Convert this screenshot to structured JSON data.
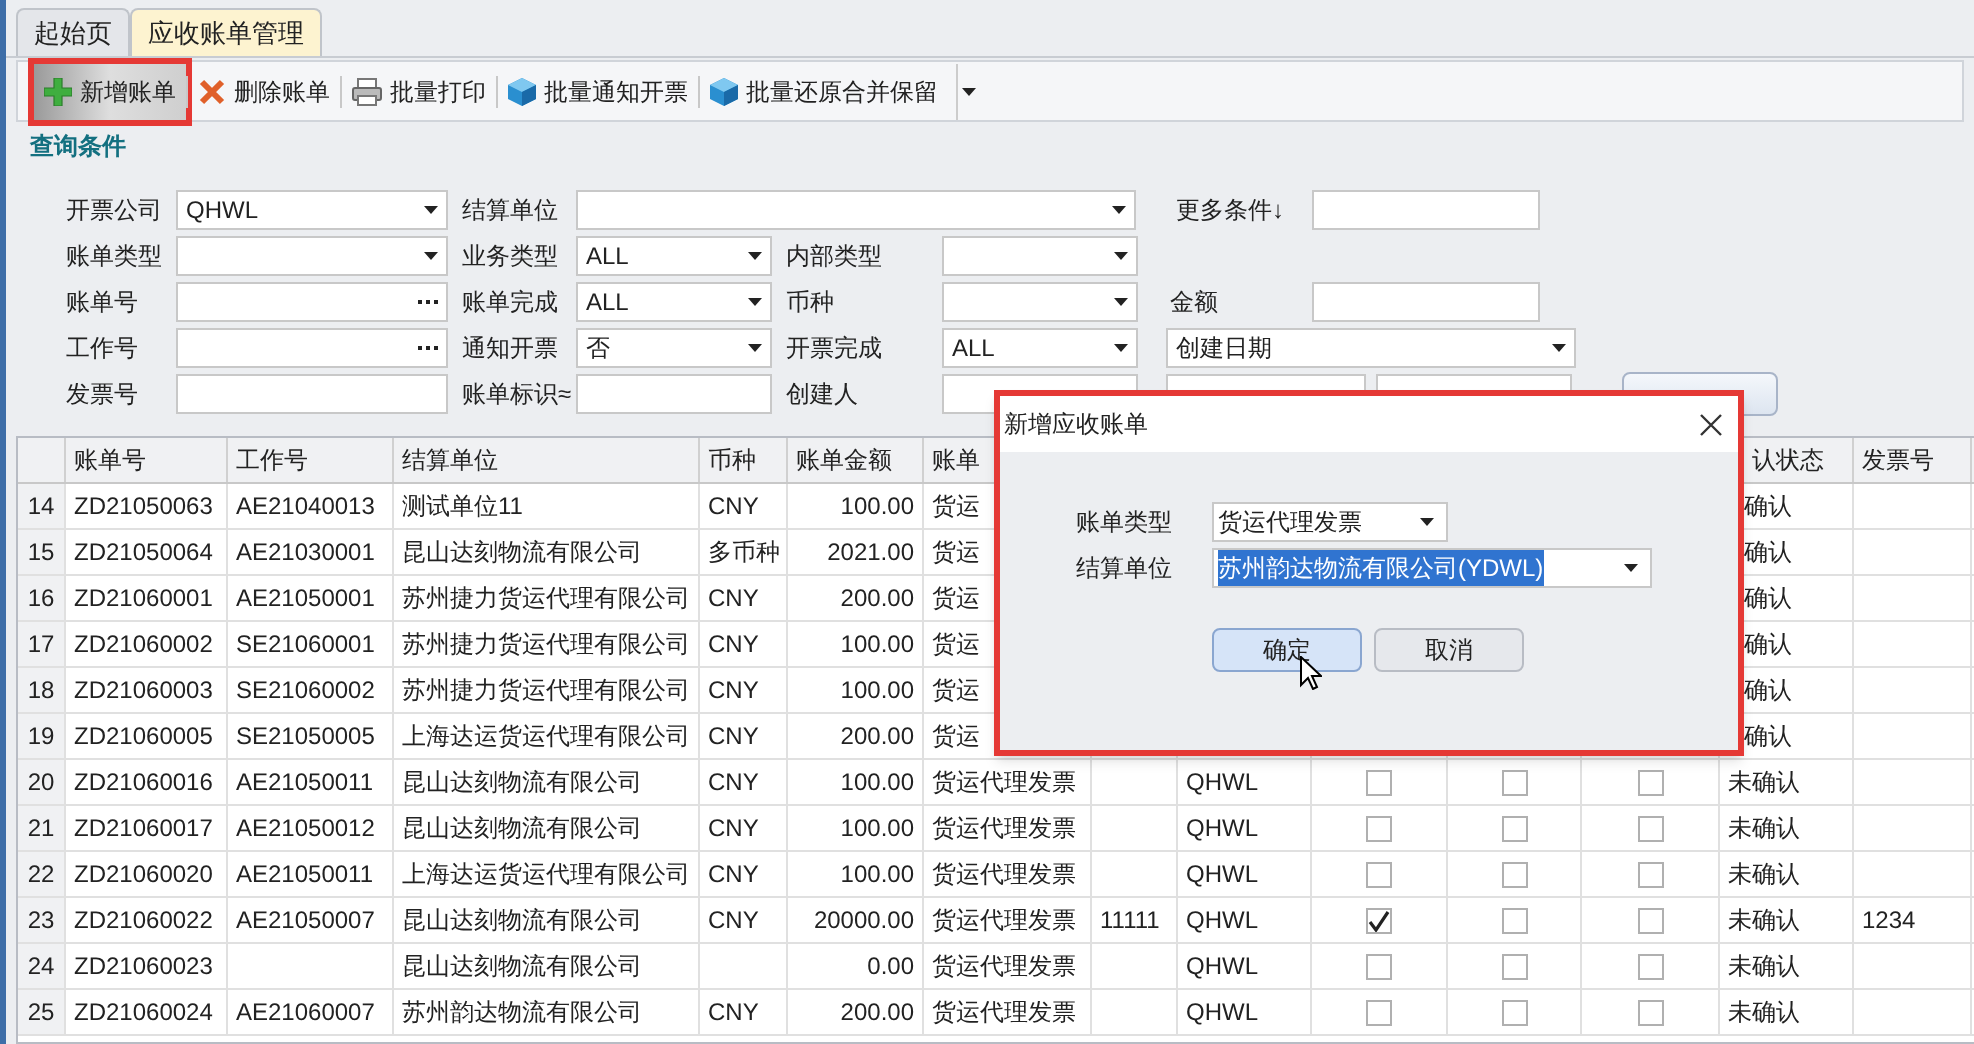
{
  "tabs": [
    {
      "label": "起始页",
      "selected": false
    },
    {
      "label": "应收账单管理",
      "selected": true
    }
  ],
  "toolbar": [
    {
      "label": "新增账单",
      "kind": "add",
      "highlighted": true
    },
    {
      "label": "删除账单",
      "kind": "delete",
      "highlighted": false
    },
    {
      "label": "批量打印",
      "kind": "print",
      "highlighted": false
    },
    {
      "label": "批量通知开票",
      "kind": "batch",
      "highlighted": false
    },
    {
      "label": "批量还原合并保留",
      "kind": "batch",
      "highlighted": false
    }
  ],
  "filter": {
    "title": "查询条件",
    "fields": [
      {
        "label": "开票公司",
        "kind": "select",
        "value": "QHWL"
      },
      {
        "label": "结算单位",
        "kind": "select"
      },
      {
        "label": "更多条件↓",
        "kind": "text"
      },
      {
        "label": "账单类型",
        "kind": "select"
      },
      {
        "label": "业务类型",
        "kind": "select",
        "value": "ALL"
      },
      {
        "label": "内部类型",
        "kind": "select"
      },
      {
        "label": "账单号",
        "kind": "picker"
      },
      {
        "label": "账单完成",
        "kind": "select",
        "value": "ALL"
      },
      {
        "label": "币种",
        "kind": "select"
      },
      {
        "label": "金额",
        "kind": "text"
      },
      {
        "label": "工作号",
        "kind": "picker"
      },
      {
        "label": "通知开票",
        "kind": "select",
        "value": "否"
      },
      {
        "label": "开票完成",
        "kind": "select",
        "value": "ALL"
      },
      {
        "kind": "select",
        "value": "创建日期"
      },
      {
        "label": "发票号",
        "kind": "text"
      },
      {
        "label": "账单标识≈",
        "kind": "text"
      },
      {
        "label": "创建人",
        "kind": "text"
      },
      {
        "kind": "select"
      },
      {
        "kind": "select"
      },
      {
        "kind": "button"
      }
    ]
  },
  "table": {
    "columns": {
      "bill_no": "账单号",
      "job_no": "工作号",
      "unit": "结算单位",
      "currency": "币种",
      "amount": "账单金额",
      "bill_type": "账单",
      "status": "认状态",
      "invoice_no": "发票号"
    },
    "rows": [
      {
        "no": "14",
        "bill_no": "ZD21050063",
        "job_no": "AE21040013",
        "unit": "测试单位11",
        "currency": "CNY",
        "amount": "100.00",
        "bill_type": "货运",
        "status": "确认"
      },
      {
        "no": "15",
        "bill_no": "ZD21050064",
        "job_no": "AE21030001",
        "unit": "昆山达刻物流有限公司",
        "currency": "多币种",
        "amount": "2021.00",
        "bill_type": "货运",
        "status": "确认"
      },
      {
        "no": "16",
        "bill_no": "ZD21060001",
        "job_no": "AE21050001",
        "unit": "苏州捷力货运代理有限公司",
        "currency": "CNY",
        "amount": "200.00",
        "bill_type": "货运",
        "status": "确认"
      },
      {
        "no": "17",
        "bill_no": "ZD21060002",
        "job_no": "SE21060001",
        "unit": "苏州捷力货运代理有限公司",
        "currency": "CNY",
        "amount": "100.00",
        "bill_type": "货运",
        "status": "确认"
      },
      {
        "no": "18",
        "bill_no": "ZD21060003",
        "job_no": "SE21060002",
        "unit": "苏州捷力货运代理有限公司",
        "currency": "CNY",
        "amount": "100.00",
        "bill_type": "货运",
        "status": "确认"
      },
      {
        "no": "19",
        "bill_no": "ZD21060005",
        "job_no": "SE21050005",
        "unit": "上海达运货运代理有限公司",
        "currency": "CNY",
        "amount": "200.00",
        "bill_type": "货运",
        "status": "确认"
      },
      {
        "no": "20",
        "bill_no": "ZD21060016",
        "job_no": "AE21050011",
        "unit": "昆山达刻物流有限公司",
        "currency": "CNY",
        "amount": "100.00",
        "bill_type": "货运代理发票",
        "company": "QHWL",
        "checks": [
          false,
          false,
          false
        ],
        "status": "未确认"
      },
      {
        "no": "21",
        "bill_no": "ZD21060017",
        "job_no": "AE21050012",
        "unit": "昆山达刻物流有限公司",
        "currency": "CNY",
        "amount": "100.00",
        "bill_type": "货运代理发票",
        "company": "QHWL",
        "checks": [
          false,
          false,
          false
        ],
        "status": "未确认"
      },
      {
        "no": "22",
        "bill_no": "ZD21060020",
        "job_no": "AE21050011",
        "unit": "上海达运货运代理有限公司",
        "currency": "CNY",
        "amount": "100.00",
        "bill_type": "货运代理发票",
        "company": "QHWL",
        "checks": [
          false,
          false,
          false
        ],
        "status": "未确认"
      },
      {
        "no": "23",
        "bill_no": "ZD21060022",
        "job_no": "AE21050007",
        "unit": "昆山达刻物流有限公司",
        "currency": "CNY",
        "amount": "20000.00",
        "bill_type": "货运代理发票",
        "column_8": "11111",
        "company": "QHWL",
        "checks": [
          true,
          false,
          false
        ],
        "status": "未确认",
        "invoice_no": "1234"
      },
      {
        "no": "24",
        "bill_no": "ZD21060023",
        "unit": "昆山达刻物流有限公司",
        "amount": "0.00",
        "bill_type": "货运代理发票",
        "company": "QHWL",
        "checks": [
          false,
          false,
          false
        ],
        "status": "未确认"
      },
      {
        "no": "25",
        "bill_no": "ZD21060024",
        "job_no": "AE21060007",
        "unit": "苏州韵达物流有限公司",
        "currency": "CNY",
        "amount": "200.00",
        "bill_type": "货运代理发票",
        "company": "QHWL",
        "checks": [
          false,
          false,
          false
        ],
        "status": "未确认"
      }
    ]
  },
  "dialog": {
    "title": "新增应收账单",
    "fields": [
      {
        "label": "账单类型",
        "value": "货运代理发票",
        "highlighted": false
      },
      {
        "label": "结算单位",
        "value": "苏州韵达物流有限公司(YDWL)",
        "highlighted": true
      }
    ],
    "buttons": [
      {
        "label": "确定",
        "focused": true
      },
      {
        "label": "取消",
        "focused": false
      }
    ]
  }
}
